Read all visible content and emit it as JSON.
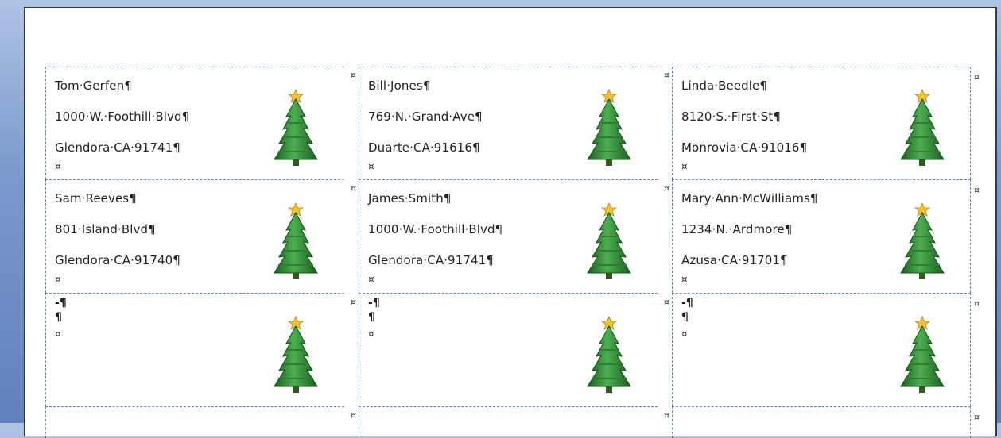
{
  "symbols": {
    "paragraph": "¶",
    "end_of_cell": "¤"
  },
  "labels": [
    {
      "name": "Tom·Gerfen¶",
      "street": "1000·W.·Foothill·Blvd¶",
      "city": "Glendora·CA·91741¶",
      "end": "¤"
    },
    {
      "name": "Bill·Jones¶",
      "street": "769·N.·Grand·Ave¶",
      "city": "Duarte·CA·91616¶",
      "end": "¤"
    },
    {
      "name": "Linda·Beedle¶",
      "street": "8120·S.·First·St¶",
      "city": "Monrovia·CA·91016¶",
      "end": "¤"
    },
    {
      "name": "Sam·Reeves¶",
      "street": "801·Island·Blvd¶",
      "city": "Glendora·CA·91740¶",
      "end": "¤"
    },
    {
      "name": "James·Smith¶",
      "street": "1000·W.·Foothill·Blvd¶",
      "city": "Glendora·CA·91741¶",
      "end": "¤"
    },
    {
      "name": "Mary·Ann·McWilliams¶",
      "street": "1234·N.·Ardmore¶",
      "city": "Azusa·CA·91701¶",
      "end": "¤"
    },
    {
      "empty1": "-¶",
      "empty2": "¶",
      "end": "¤"
    },
    {
      "empty1": "-¶",
      "empty2": "¶",
      "end": "¤"
    },
    {
      "empty1": "-¶",
      "empty2": "¶",
      "end": "¤"
    }
  ],
  "colors": {
    "gridline": "#5b85d6",
    "tree_dark": "#1b5e20",
    "tree_light": "#43a047",
    "star": "#f4c430"
  },
  "icons": {
    "tree": "christmas-tree-icon",
    "star": "star-icon"
  }
}
